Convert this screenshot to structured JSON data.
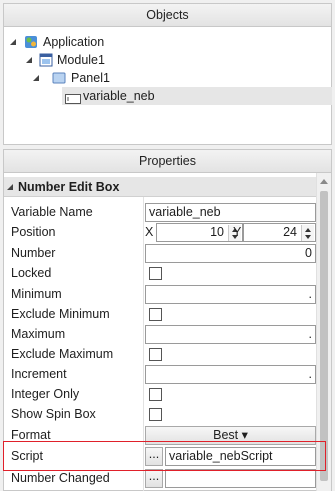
{
  "objects_panel": {
    "title": "Objects",
    "tree": [
      {
        "label": "Application",
        "icon": "application-icon"
      },
      {
        "label": "Module1",
        "icon": "module-icon"
      },
      {
        "label": "Panel1",
        "icon": "panel-icon"
      },
      {
        "label": "variable_neb",
        "icon": "number-edit-box-icon",
        "selected": true
      }
    ]
  },
  "properties_panel": {
    "title": "Properties",
    "section": "Number Edit Box",
    "rows": {
      "variable_name": {
        "label": "Variable Name",
        "value": "variable_neb"
      },
      "position": {
        "label": "Position",
        "x_label": "X",
        "x_value": "10",
        "y_label": "Y",
        "y_value": "24"
      },
      "number": {
        "label": "Number",
        "value": "0"
      },
      "locked": {
        "label": "Locked"
      },
      "minimum": {
        "label": "Minimum",
        "value": "."
      },
      "exclude_minimum": {
        "label": "Exclude Minimum"
      },
      "maximum": {
        "label": "Maximum",
        "value": "."
      },
      "exclude_maximum": {
        "label": "Exclude Maximum"
      },
      "increment": {
        "label": "Increment",
        "value": "."
      },
      "integer_only": {
        "label": "Integer Only"
      },
      "show_spin_box": {
        "label": "Show Spin Box"
      },
      "format": {
        "label": "Format",
        "button": "Best ▾"
      },
      "script": {
        "label": "Script",
        "button": "...",
        "value": "variable_nebScript"
      },
      "number_changed": {
        "label": "Number Changed",
        "button": "...",
        "value": ""
      }
    }
  },
  "colors": {
    "highlight": "#e0202a",
    "selection": "#e6e6e6"
  }
}
